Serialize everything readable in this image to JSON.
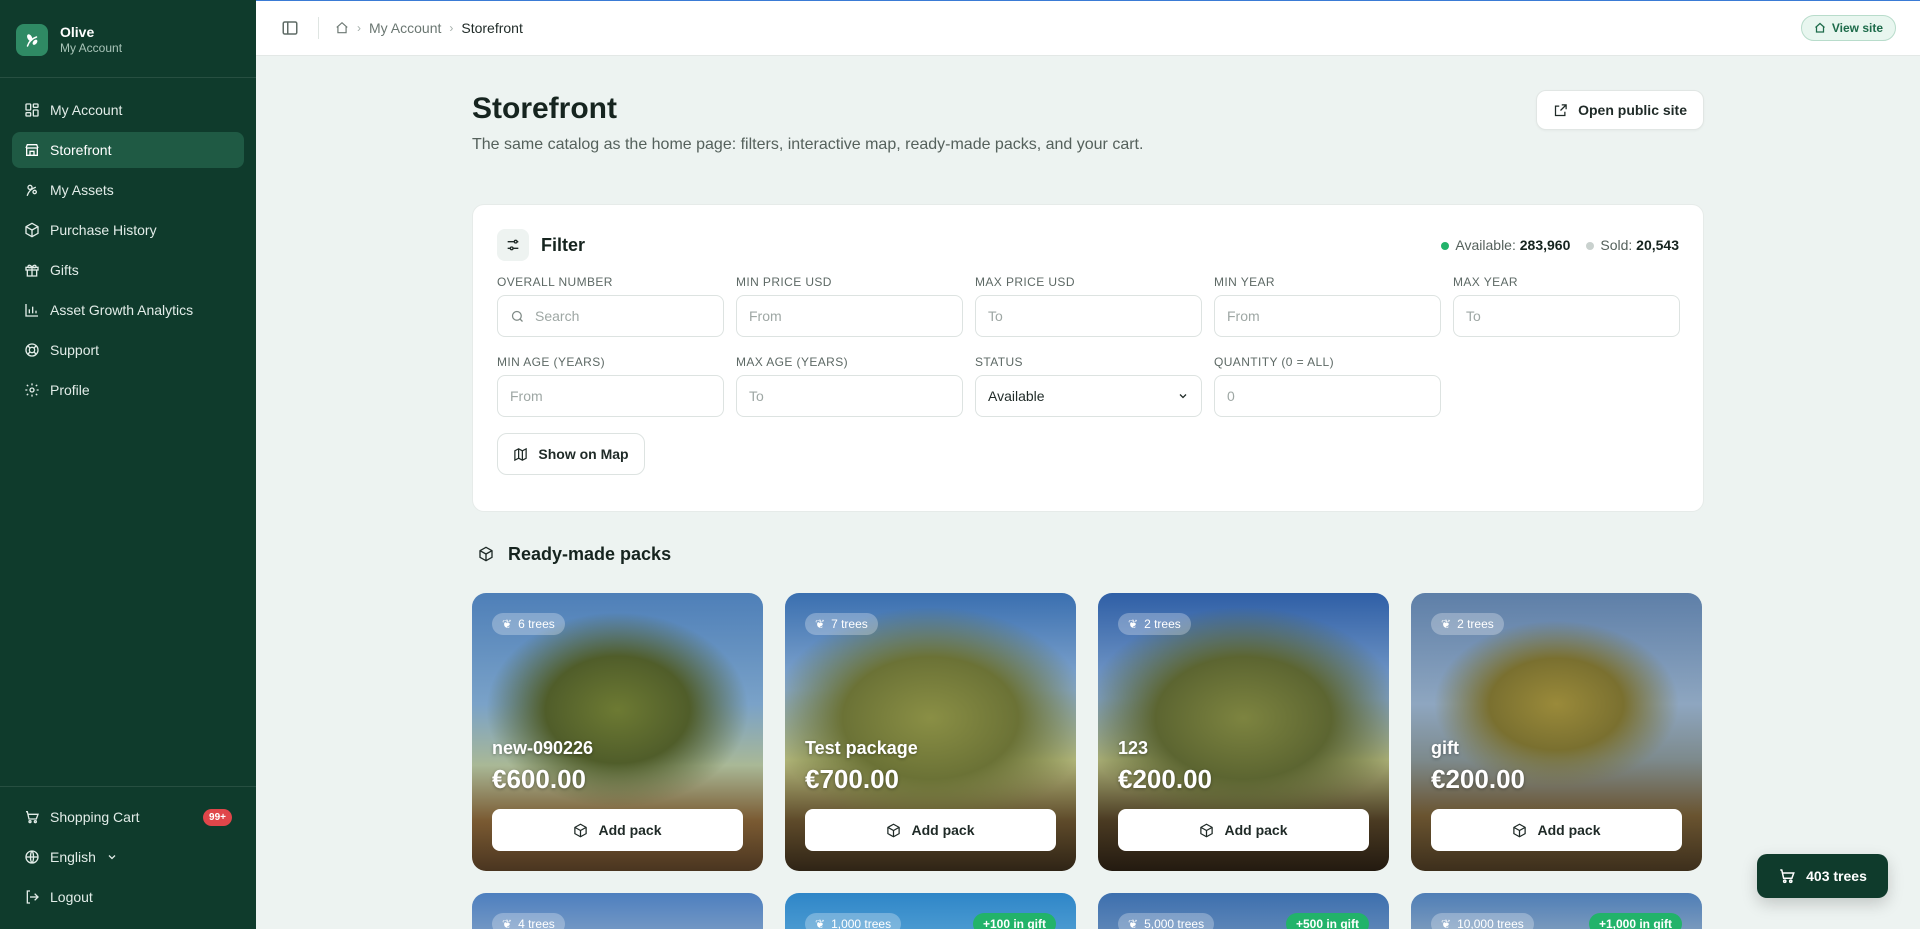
{
  "brand": {
    "name": "Olive",
    "subtitle": "My Account"
  },
  "sidebar": {
    "items": [
      {
        "label": "My Account",
        "icon": "dashboard-icon"
      },
      {
        "label": "Storefront",
        "icon": "store-icon",
        "active": true
      },
      {
        "label": "My Assets",
        "icon": "olive-icon"
      },
      {
        "label": "Purchase History",
        "icon": "package-icon"
      },
      {
        "label": "Gifts",
        "icon": "gift-icon"
      },
      {
        "label": "Asset Growth Analytics",
        "icon": "bar-chart-icon"
      },
      {
        "label": "Support",
        "icon": "lifebuoy-icon"
      },
      {
        "label": "Profile",
        "icon": "gear-icon"
      }
    ],
    "bottom": {
      "cart_label": "Shopping Cart",
      "cart_badge": "99+",
      "language": "English",
      "logout": "Logout"
    }
  },
  "topbar": {
    "breadcrumb": [
      "My Account",
      "Storefront"
    ],
    "view_site": "View site"
  },
  "page": {
    "title": "Storefront",
    "description": "The same catalog as the home page: filters, interactive map, ready-made packs, and your cart.",
    "open_public": "Open public site"
  },
  "filter": {
    "title": "Filter",
    "available_label": "Available:",
    "available_value": "283,960",
    "sold_label": "Sold:",
    "sold_value": "20,543",
    "fields": {
      "overall_number": {
        "label": "Overall Number",
        "placeholder": "Search"
      },
      "min_price": {
        "label": "Min Price USD",
        "placeholder": "From"
      },
      "max_price": {
        "label": "Max Price USD",
        "placeholder": "To"
      },
      "min_year": {
        "label": "Min Year",
        "placeholder": "From"
      },
      "max_year": {
        "label": "Max Year",
        "placeholder": "To"
      },
      "min_age": {
        "label": "Min Age (Years)",
        "placeholder": "From"
      },
      "max_age": {
        "label": "Max Age (Years)",
        "placeholder": "To"
      },
      "status": {
        "label": "Status",
        "value": "Available"
      },
      "quantity": {
        "label": "Quantity (0 = All)",
        "placeholder": "0"
      }
    },
    "map_button": "Show on Map"
  },
  "packs": {
    "title": "Ready-made packs",
    "add_label": "Add pack",
    "items": [
      {
        "trees": "6 trees",
        "name": "new-090226",
        "price": "€600.00"
      },
      {
        "trees": "7 trees",
        "name": "Test package",
        "price": "€700.00"
      },
      {
        "trees": "2 trees",
        "name": "123",
        "price": "€200.00"
      },
      {
        "trees": "2 trees",
        "name": "gift",
        "price": "€200.00"
      },
      {
        "trees": "4 trees"
      },
      {
        "trees": "1,000 trees",
        "gift": "+100 in gift"
      },
      {
        "trees": "5,000 trees",
        "gift": "+500 in gift"
      },
      {
        "trees": "10,000 trees",
        "gift": "+1,000 in gift"
      }
    ]
  },
  "cart_fab": {
    "label": "403 trees"
  },
  "colors": {
    "sidebar": "#0f3b2c",
    "accent": "#22b36a",
    "badge": "#e0464a"
  }
}
